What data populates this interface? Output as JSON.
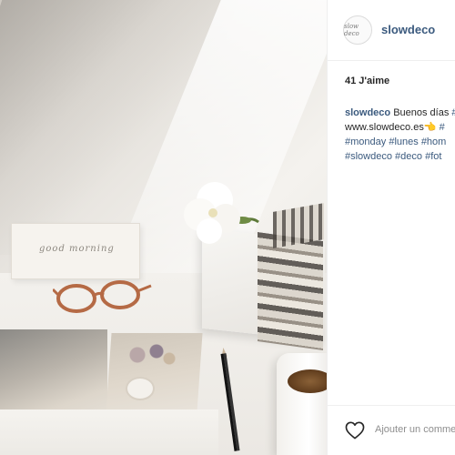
{
  "post": {
    "username": "slowdeco",
    "avatar_text": "slow deco",
    "likes": "41 J'aime",
    "caption": {
      "user": "slowdeco",
      "text": "Buenos días",
      "link": "www.slowdeco.es",
      "emoji": "👈",
      "tags_line1": [
        "#monday",
        "#lunes",
        "#hom"
      ],
      "tags_line2": [
        "#slowdeco",
        "#deco",
        "#fot"
      ],
      "line1_trailing": "#"
    },
    "comment_placeholder": "Ajouter un commentaire..."
  },
  "photo": {
    "card_text": "good morning"
  },
  "icons": {
    "like": "heart-icon"
  },
  "colors": {
    "link_blue": "#3b5a7e",
    "text": "#262626",
    "muted": "#8e8e8e"
  }
}
